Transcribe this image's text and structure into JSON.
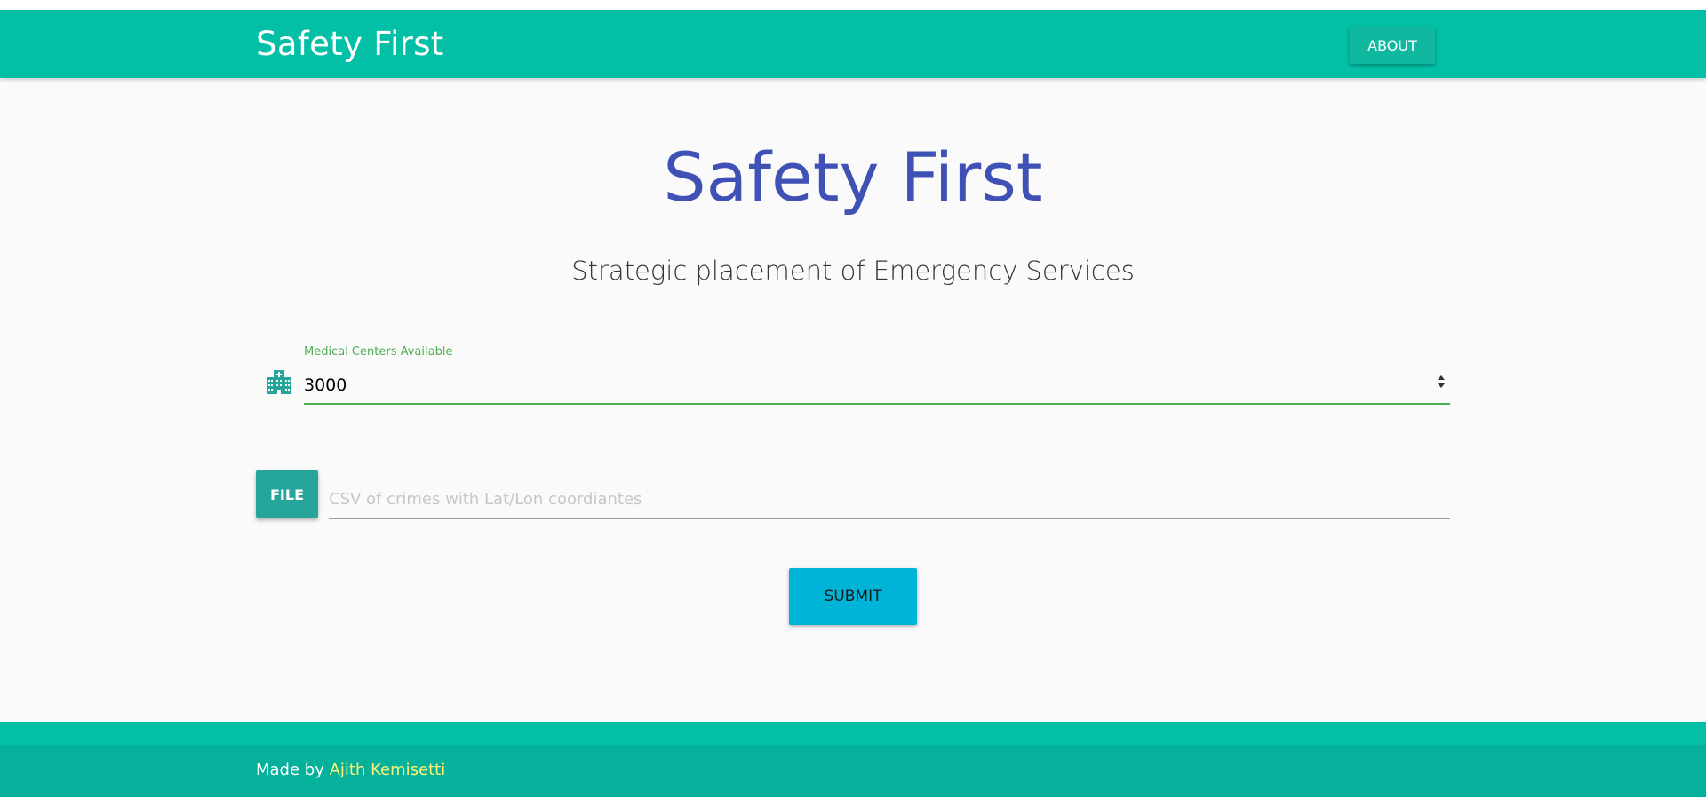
{
  "navbar": {
    "brand": "Safety First",
    "about_label": "ABOUT"
  },
  "hero": {
    "title": "Safety First",
    "subtitle": "Strategic placement of Emergency Services"
  },
  "form": {
    "medical_centers": {
      "label": "Medical Centers Available",
      "value": "3000",
      "icon": "hospital-icon"
    },
    "file_upload": {
      "button_label": "FILE",
      "placeholder": "CSV of crimes with Lat/Lon coordiantes"
    },
    "submit_label": "SUBMIT"
  },
  "footer": {
    "made_by": "Made by",
    "author": "Ajith Kemisetti"
  },
  "colors": {
    "primary": "#02bfa5",
    "title": "#3f51b5",
    "valid": "#4caf50",
    "file_button": "#26a69a",
    "submit": "#00b4d8",
    "footer_link": "#fff176"
  }
}
